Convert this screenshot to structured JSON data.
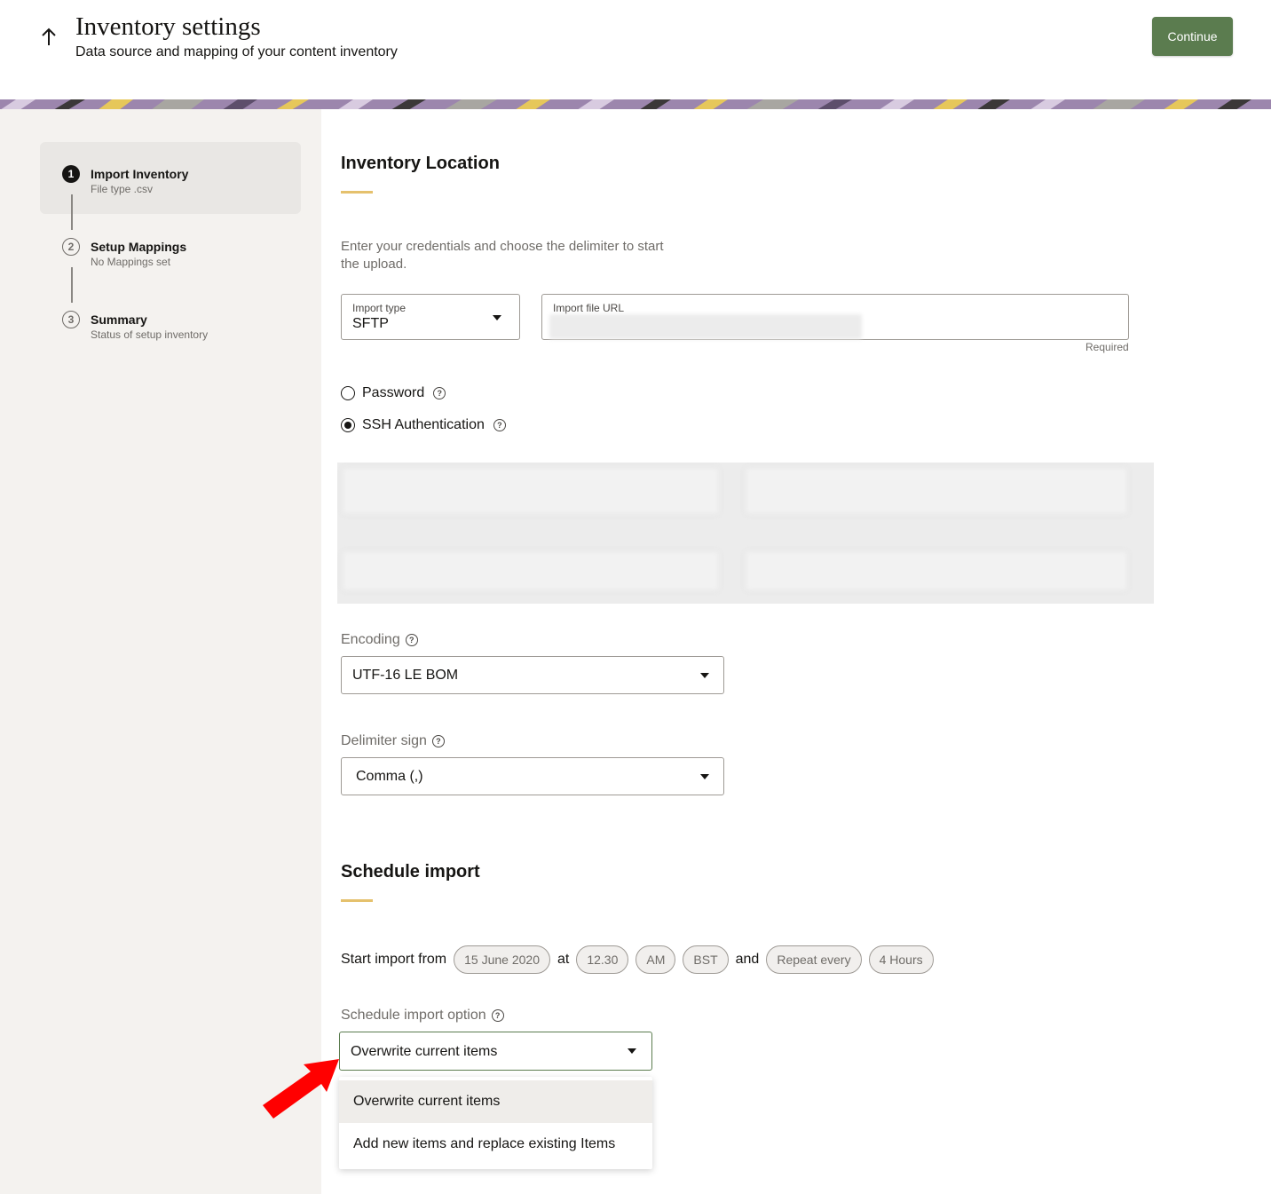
{
  "header": {
    "title": "Inventory settings",
    "subtitle": "Data source and mapping of your content inventory",
    "continue_label": "Continue",
    "back_icon": "arrow-up-icon"
  },
  "steps": [
    {
      "number": "1",
      "title": "Import Inventory",
      "subtitle": "File type .csv",
      "active": true
    },
    {
      "number": "2",
      "title": "Setup Mappings",
      "subtitle": "No Mappings set",
      "active": false
    },
    {
      "number": "3",
      "title": "Summary",
      "subtitle": "Status of setup inventory",
      "active": false
    }
  ],
  "location": {
    "title": "Inventory Location",
    "intro": "Enter your credentials and choose the delimiter to start the upload.",
    "import_type": {
      "label": "Import type",
      "value": "SFTP"
    },
    "import_url": {
      "label": "Import file URL",
      "helper": "Required"
    },
    "auth_options": [
      {
        "label": "Password",
        "selected": false
      },
      {
        "label": "SSH Authentication",
        "selected": true
      }
    ]
  },
  "encoding": {
    "label": "Encoding",
    "value": "UTF-16 LE BOM"
  },
  "delimiter": {
    "label": "Delimiter sign",
    "value": "Comma (,)"
  },
  "schedule": {
    "title": "Schedule import",
    "start_label": "Start import from",
    "date": "15 June 2020",
    "at_label": "at",
    "time": "12.30",
    "meridiem": "AM",
    "timezone": "BST",
    "and_label": "and",
    "repeat": "Repeat every",
    "interval": "4 Hours",
    "option_label": "Schedule import option",
    "option_value": "Overwrite current items",
    "options": [
      "Overwrite current items",
      "Add new items and replace existing Items"
    ]
  },
  "colors": {
    "primary_button": "#5b7c4f",
    "accent": "#e5c16d",
    "sidebar_bg": "#f4f2ef",
    "annotation_arrow": "#ff0000"
  }
}
